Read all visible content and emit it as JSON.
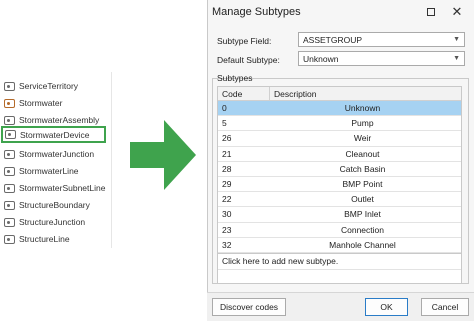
{
  "tree": {
    "items": [
      {
        "label": "ServiceTerritory",
        "icon": "layer-icon"
      },
      {
        "label": "Stormwater",
        "icon": "network-icon"
      },
      {
        "label": "StormwaterAssembly",
        "icon": "layer-icon"
      },
      {
        "label": "StormwaterDevice",
        "icon": "layer-icon"
      },
      {
        "label": "StormwaterJunction",
        "icon": "layer-icon"
      },
      {
        "label": "StormwaterLine",
        "icon": "layer-icon"
      },
      {
        "label": "StormwaterSubnetLine",
        "icon": "layer-icon"
      },
      {
        "label": "StructureBoundary",
        "icon": "layer-icon"
      },
      {
        "label": "StructureJunction",
        "icon": "layer-icon"
      },
      {
        "label": "StructureLine",
        "icon": "layer-icon"
      }
    ],
    "highlighted": "StormwaterDevice"
  },
  "arrow_color": "#3fa34d",
  "dialog": {
    "title": "Manage Subtypes",
    "subtype_field_label": "Subtype Field:",
    "subtype_field_value": "ASSETGROUP",
    "default_subtype_label": "Default Subtype:",
    "default_subtype_value": "Unknown",
    "subtypes_label": "Subtypes",
    "columns": {
      "code": "Code",
      "description": "Description"
    },
    "rows": [
      {
        "code": "0",
        "description": "Unknown"
      },
      {
        "code": "5",
        "description": "Pump"
      },
      {
        "code": "26",
        "description": "Weir"
      },
      {
        "code": "21",
        "description": "Cleanout"
      },
      {
        "code": "28",
        "description": "Catch Basin"
      },
      {
        "code": "29",
        "description": "BMP Point"
      },
      {
        "code": "22",
        "description": "Outlet"
      },
      {
        "code": "30",
        "description": "BMP Inlet"
      },
      {
        "code": "23",
        "description": "Connection"
      },
      {
        "code": "32",
        "description": "Manhole Channel"
      }
    ],
    "selected_row": 0,
    "add_row_text": "Click here to add new subtype.",
    "buttons": {
      "discover": "Discover codes",
      "ok": "OK",
      "cancel": "Cancel"
    }
  }
}
